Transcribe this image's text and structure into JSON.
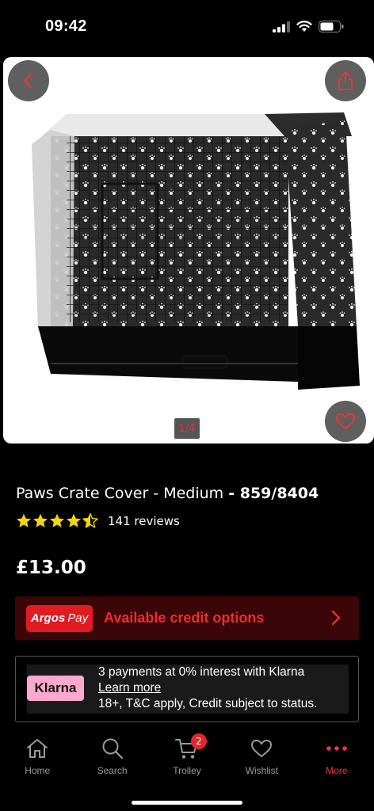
{
  "status_bar": {
    "time": "09:42"
  },
  "product": {
    "image_pager": "1/4",
    "title_name": "Paws Crate Cover - Medium",
    "title_code": "- 859/8404",
    "rating_value": 4.5,
    "reviews": "141 reviews",
    "price": "£13.00"
  },
  "argos_pay": {
    "logo_brand": "Argos",
    "logo_pay": "Pay",
    "label": "Available credit options"
  },
  "klarna": {
    "logo": "Klarna",
    "line1": "3 payments at 0% interest with Klarna",
    "link": "Learn more",
    "line3": "18+, T&C apply, Credit subject to status."
  },
  "nav": {
    "home": "Home",
    "search": "Search",
    "trolley": "Trolley",
    "trolley_badge": "2",
    "wishlist": "Wishlist",
    "more": "More"
  },
  "colors": {
    "accent": "#e01b22",
    "background": "#000000",
    "star": "#f5d60a"
  },
  "icons": [
    "back-arrow-icon",
    "share-icon",
    "heart-icon",
    "star-icon",
    "chevron-right-icon",
    "home-icon",
    "search-icon",
    "trolley-icon",
    "heart-outline-icon",
    "more-dots-icon"
  ]
}
